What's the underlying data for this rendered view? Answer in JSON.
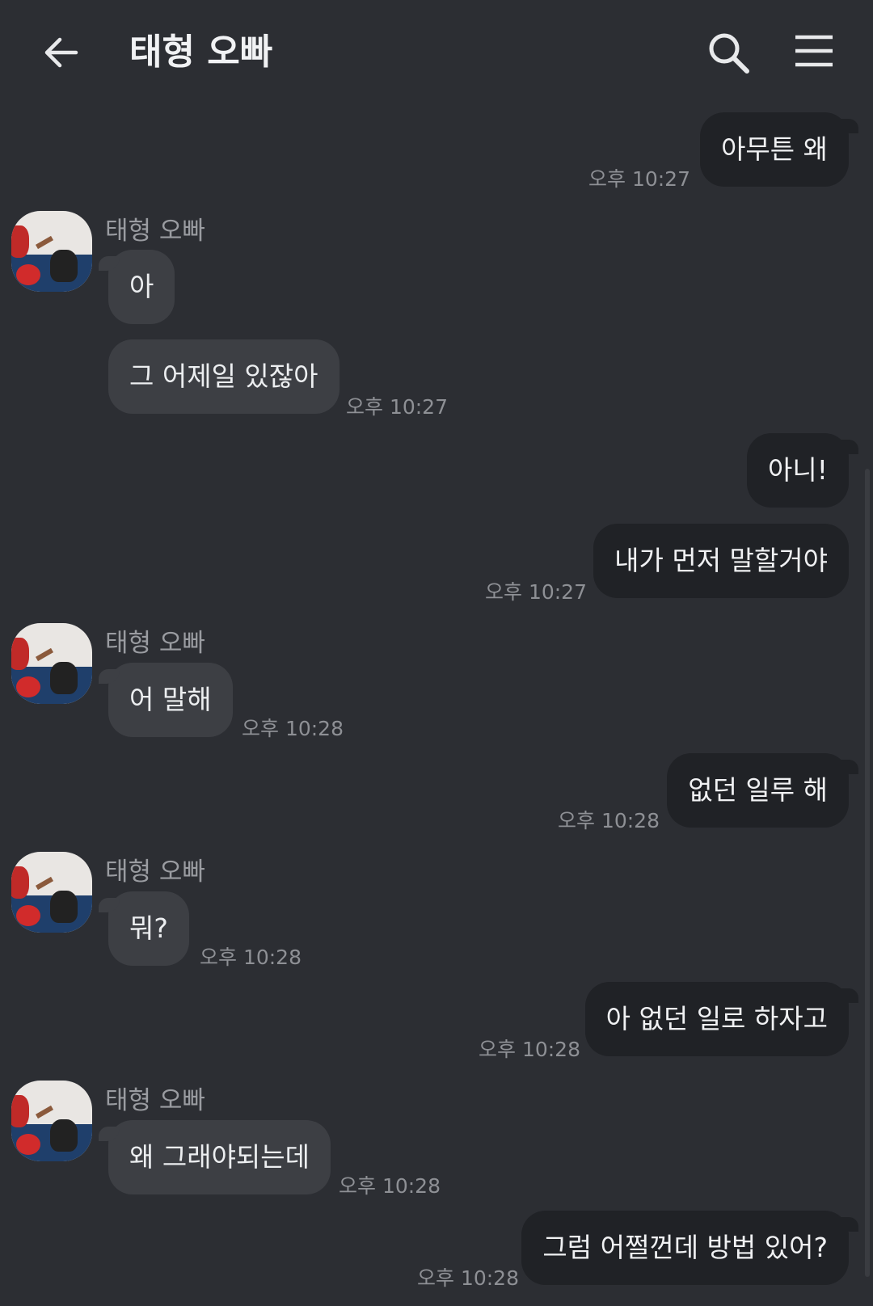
{
  "header": {
    "title": "태형 오빠",
    "back_icon": "arrow-left-icon",
    "search_icon": "search-icon",
    "menu_icon": "hamburger-menu-icon"
  },
  "colors": {
    "background": "#2c2e33",
    "outgoing_bubble": "#202226",
    "incoming_bubble": "#3d3f44",
    "timestamp": "#8e9095"
  },
  "messages": [
    {
      "direction": "out",
      "text": "아무튼 왜",
      "time": "오후 10:27"
    },
    {
      "direction": "in",
      "sender": "태형 오빠",
      "text": "아"
    },
    {
      "direction": "in",
      "text": "그 어제일 있잖아",
      "time": "오후 10:27"
    },
    {
      "direction": "out",
      "text": "아니!"
    },
    {
      "direction": "out",
      "text": "내가 먼저 말할거야",
      "time": "오후 10:27"
    },
    {
      "direction": "in",
      "sender": "태형 오빠",
      "text": "어 말해",
      "time": "오후 10:28"
    },
    {
      "direction": "out",
      "text": "없던 일루 해",
      "time": "오후 10:28"
    },
    {
      "direction": "in",
      "sender": "태형 오빠",
      "text": "뭐?",
      "time": "오후 10:28"
    },
    {
      "direction": "out",
      "text": "아 없던 일로 하자고",
      "time": "오후 10:28"
    },
    {
      "direction": "in",
      "sender": "태형 오빠",
      "text": "왜 그래야되는데",
      "time": "오후 10:28"
    },
    {
      "direction": "out",
      "text": "그럼 어쩔껀데 방법 있어?",
      "time": "오후 10:28"
    }
  ]
}
